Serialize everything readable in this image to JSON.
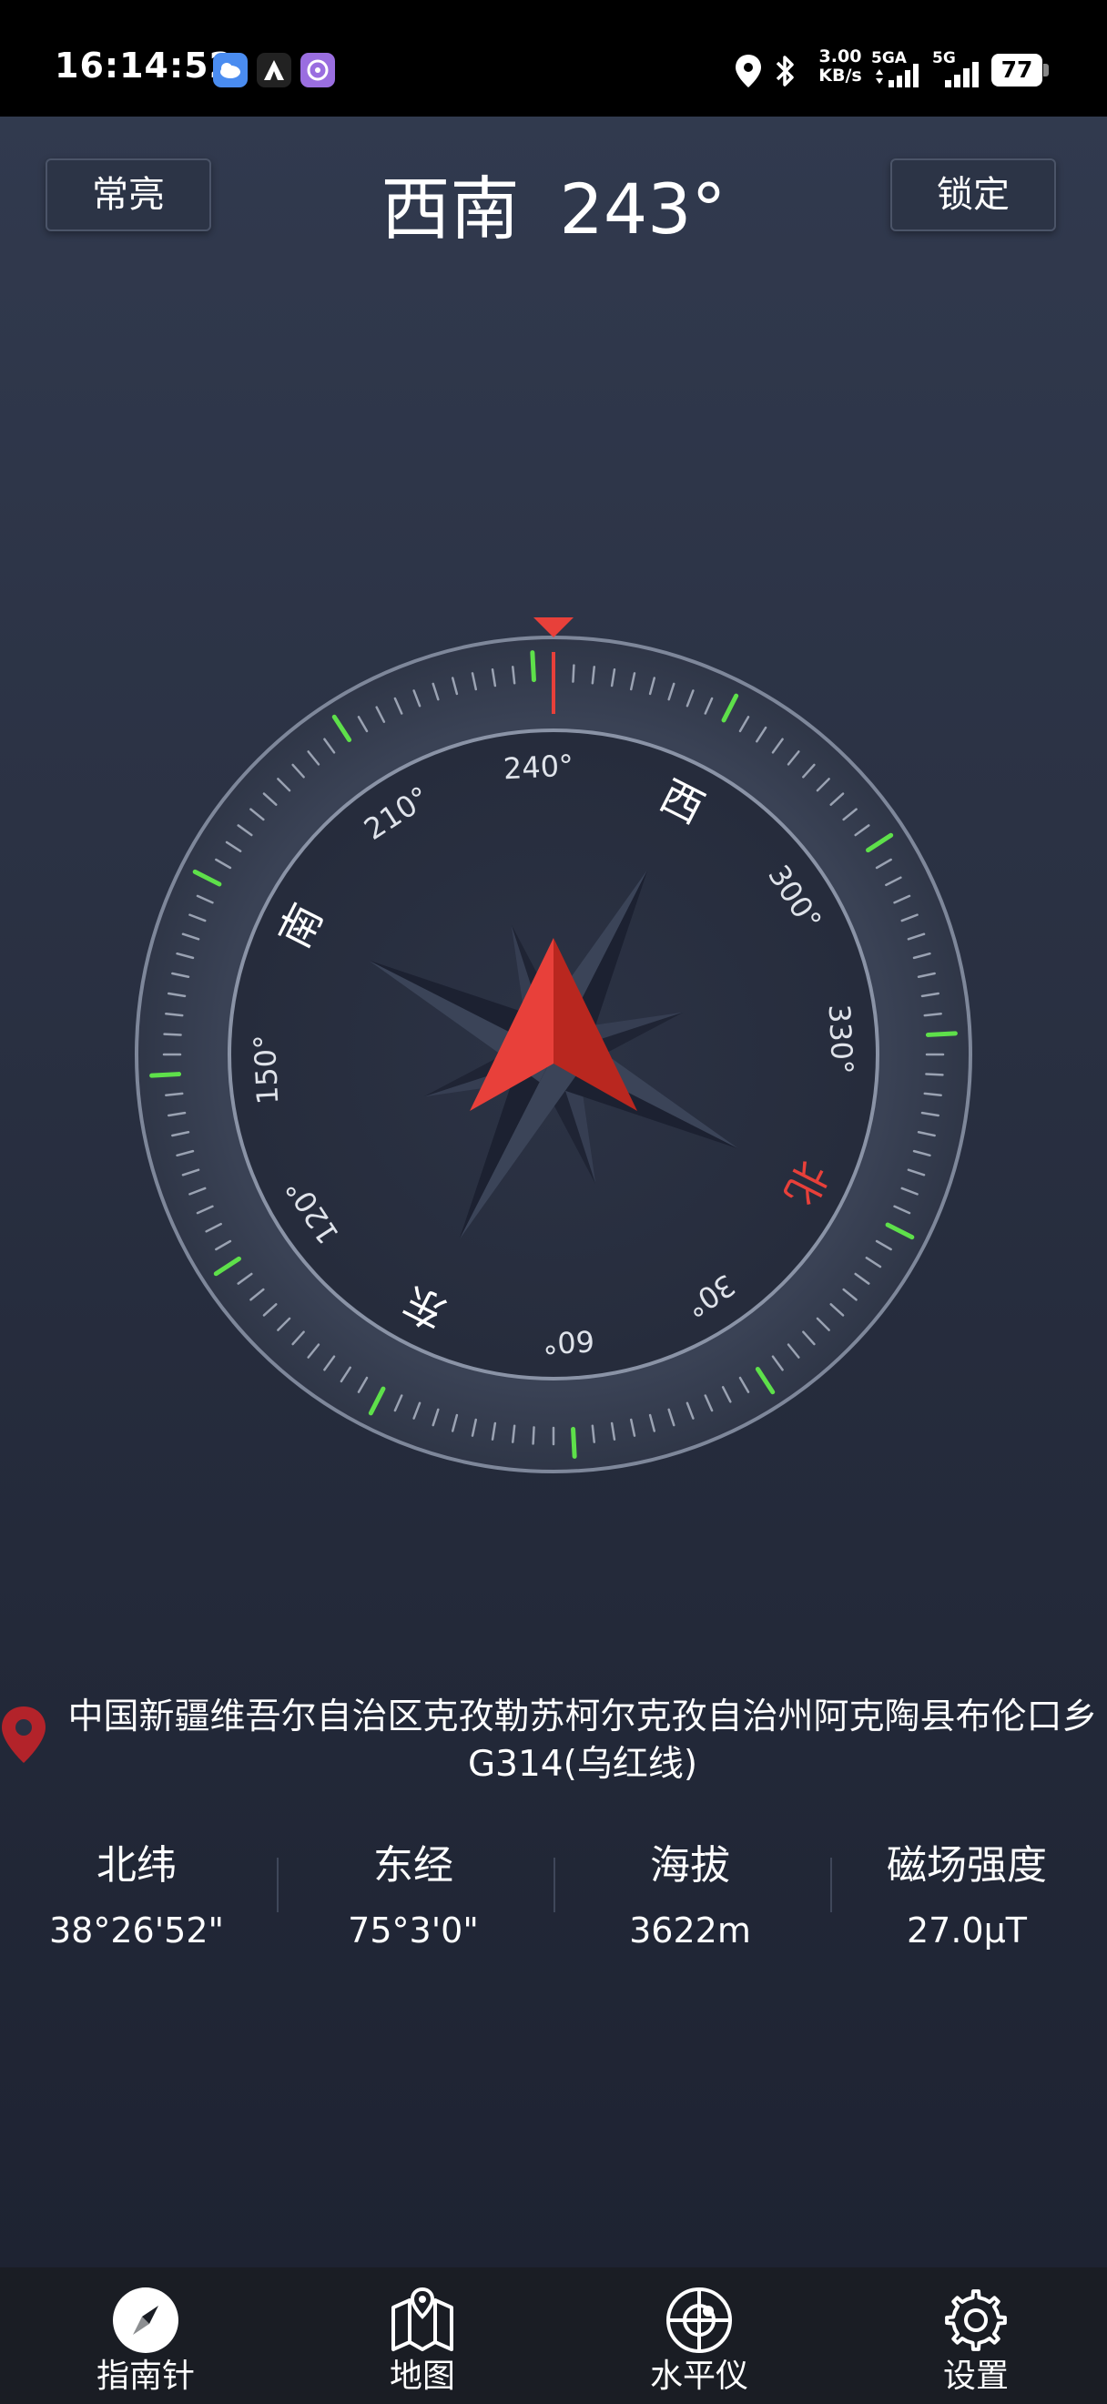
{
  "status_bar": {
    "time": "16:14:52",
    "network_speed_value": "3.00",
    "network_speed_unit": "KB/s",
    "signal_1_label": "5GA",
    "signal_2_label": "5G",
    "battery": "77"
  },
  "header": {
    "left_button": "常亮",
    "direction": "西南",
    "degrees": "243°",
    "right_button": "锁定"
  },
  "compass": {
    "heading_degrees": 243,
    "degree_labels": [
      "30°",
      "60°",
      "120°",
      "150°",
      "210°",
      "240°",
      "300°",
      "330°"
    ],
    "cardinal_labels": {
      "north": "北",
      "east": "东",
      "south": "南",
      "west": "西"
    },
    "colors": {
      "north_label": "#e8403a",
      "needle": "#e8403a",
      "accent_ticks": "#5ee04a"
    }
  },
  "location": {
    "address": "中国新疆维吾尔自治区克孜勒苏柯尔克孜自治州阿克陶县布伦口乡G314(乌红线)"
  },
  "stats": [
    {
      "label": "北纬",
      "value": "38°26'52\""
    },
    {
      "label": "东经",
      "value": "75°3'0\""
    },
    {
      "label": "海拔",
      "value": "3622m"
    },
    {
      "label": "磁场强度",
      "value": "27.0μT"
    }
  ],
  "nav": [
    {
      "label": "指南针",
      "icon": "compass-icon"
    },
    {
      "label": "地图",
      "icon": "map-icon"
    },
    {
      "label": "水平仪",
      "icon": "level-icon"
    },
    {
      "label": "设置",
      "icon": "gear-icon"
    }
  ]
}
